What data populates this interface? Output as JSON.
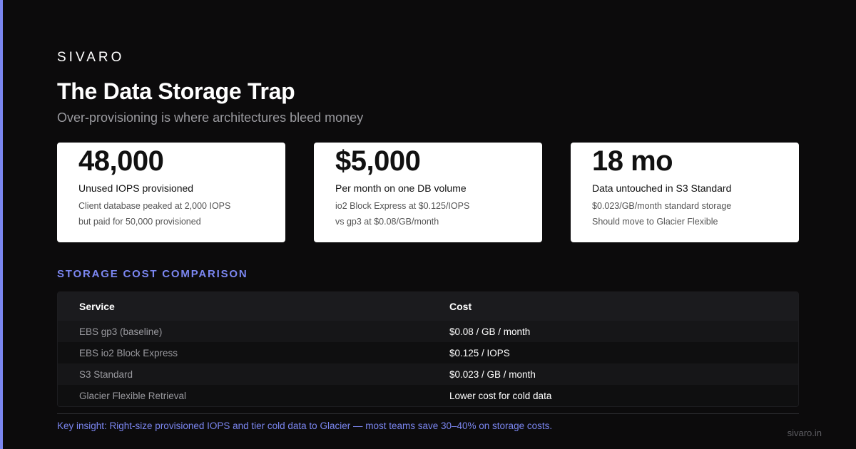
{
  "brand": "SIVARO",
  "title": "The Data Storage Trap",
  "subtitle": "Over-provisioning is where architectures bleed money",
  "colors": {
    "accent": "#7b86f0",
    "background": "#0c0b0c",
    "card": "#ffffff"
  },
  "cards": [
    {
      "value": "48,000",
      "label": "Unused IOPS provisioned",
      "detail_1": "Client database peaked at 2,000 IOPS",
      "detail_2": "but paid for 50,000 provisioned"
    },
    {
      "value": "$5,000",
      "label": "Per month on one DB volume",
      "detail_1": "io2 Block Express at $0.125/IOPS",
      "detail_2": "vs gp3 at $0.08/GB/month"
    },
    {
      "value": "18 mo",
      "label": "Data untouched in S3 Standard",
      "detail_1": "$0.023/GB/month standard storage",
      "detail_2": "Should move to Glacier Flexible"
    }
  ],
  "table": {
    "section_title": "STORAGE COST COMPARISON",
    "headers": {
      "service": "Service",
      "cost": "Cost"
    },
    "rows": [
      {
        "service": "EBS gp3 (baseline)",
        "cost": "$0.08 / GB / month"
      },
      {
        "service": "EBS io2 Block Express",
        "cost": "$0.125 / IOPS"
      },
      {
        "service": "S3 Standard",
        "cost": "$0.023 / GB / month"
      },
      {
        "service": "Glacier Flexible Retrieval",
        "cost": "Lower cost for cold data"
      }
    ]
  },
  "insight": "Key insight: Right-size provisioned IOPS and tier cold data to Glacier — most teams save 30–40% on storage costs.",
  "footer_url": "sivaro.in"
}
